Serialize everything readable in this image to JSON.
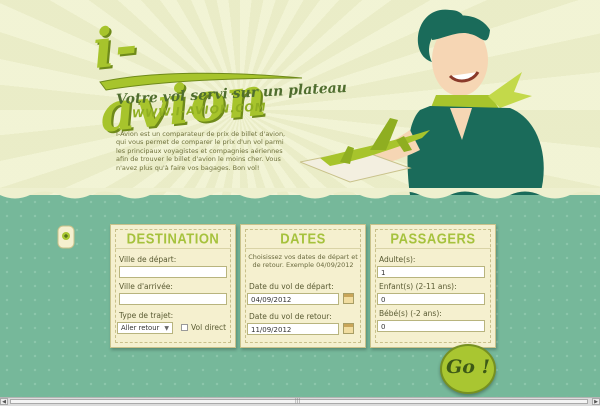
{
  "header": {
    "logo": "i-avion",
    "tagline": "Votre vol servi sur un plateau",
    "website": "WWW.I-AVION.COM",
    "intro": "I-Avion est un comparateur de prix de billet d'avion, qui vous permet de comparer le prix d'un vol parmi les principaux voyagistes et compagnies aériennes afin de trouver le billet d'avion le moins cher. Vous n'avez plus qu'à faire vos bagages. Bon vol!"
  },
  "destination": {
    "title": "DESTINATION",
    "departure_label": "Ville de départ:",
    "departure_value": "",
    "arrival_label": "Ville d'arrivée:",
    "arrival_value": "",
    "trip_type_label": "Type de trajet:",
    "trip_type_value": "Aller retour",
    "direct_label": "Vol direct"
  },
  "dates": {
    "title": "DATES",
    "hint": "Choisissez vos dates de départ et de retour. Exemple 04/09/2012",
    "depart_label": "Date du vol de départ:",
    "depart_value": "04/09/2012",
    "return_label": "Date du vol de retour:",
    "return_value": "11/09/2012"
  },
  "passengers": {
    "title": "PASSAGERS",
    "adults_label": "Adulte(s):",
    "adults_value": "1",
    "children_label": "Enfant(s) (2-11 ans):",
    "children_value": "0",
    "babies_label": "Bébé(s) (-2 ans):",
    "babies_value": "0"
  },
  "go_button": "Go !",
  "scrollbar": {
    "left": "◀",
    "right": "▶",
    "grip": "|||"
  },
  "colors": {
    "accent": "#a9c631",
    "background": "#76b89a",
    "panel": "#f5f0cf",
    "text": "#5a5b33"
  }
}
